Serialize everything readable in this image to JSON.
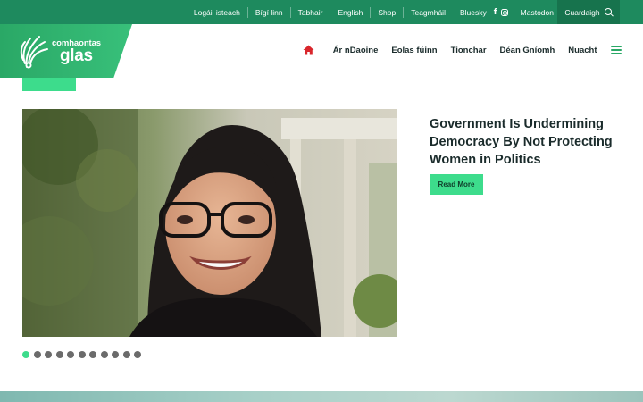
{
  "topbar": {
    "links": [
      "Logáil isteach",
      "Bígí linn",
      "Tabhair",
      "English",
      "Shop",
      "Teagmháil"
    ],
    "social": {
      "bluesky": "Bluesky",
      "facebook_glyph": "f",
      "mastodon": "Mastodon"
    },
    "search_label": "Cuardaigh",
    "color": "#1e8a5e"
  },
  "logo": {
    "line1": "comhaontas",
    "line2": "glas"
  },
  "nav": {
    "items": [
      "Ár nDaoine",
      "Eolas fúinn",
      "Tionchar",
      "Déan Gníomh",
      "Nuacht"
    ],
    "home_icon": "home-icon",
    "menu_icon": "hamburger-menu-icon"
  },
  "slide": {
    "headline": "Government Is Undermining Democracy By Not Protecting Women in Politics",
    "cta": "Read More",
    "accent": "#3ddc8c"
  },
  "carousel": {
    "total": 11,
    "active": 1
  }
}
